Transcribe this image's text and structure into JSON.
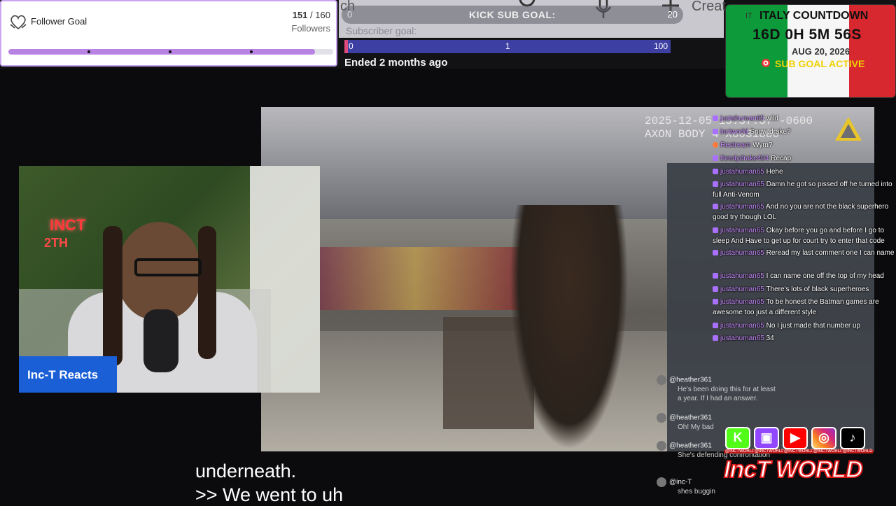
{
  "follower_goal": {
    "title": "Follower Goal",
    "current": "151",
    "separator": "/",
    "target": "160",
    "count_text": "151 / 160",
    "unit": "Followers",
    "progress_fraction": 0.944,
    "colors": {
      "fill": "#b883e3",
      "border": "#c9a6f0"
    },
    "icon": "heart-hands-icon"
  },
  "background_page": {
    "partial_label_left": "ch",
    "create_label": "Creat",
    "icons": [
      "search-icon",
      "microphone-icon",
      "plus-icon"
    ]
  },
  "kick_sub_goal": {
    "label": "KICK SUB GOAL:",
    "start": "0",
    "target": "20"
  },
  "subscriber_goal": {
    "label": "Subscriber goal:",
    "ticks": [
      "0",
      "1",
      "100"
    ],
    "status": "Ended 2 months ago",
    "colors": {
      "bar": "#3d3fa3",
      "edge": "#e04a7a"
    }
  },
  "italy_countdown": {
    "flag_prefix": "IT",
    "title": "ITALY COUNTDOWN",
    "timer": "16D 0H 5M 56S",
    "date": "AUG 20, 2026",
    "status": "SUB GOAL ACTIVE",
    "colors": {
      "green": "#0d9a3a",
      "white": "#f6f6f6",
      "red": "#d8282f",
      "status": "#f0d200"
    }
  },
  "bodycam": {
    "timestamp": "2025-12-05 15:37:37 -0600",
    "device": "AXON BODY 4 X6031886"
  },
  "facecam": {
    "neon_sign_line1": "INCT",
    "neon_sign_line2": "2TH",
    "label": "Inc-T Reacts",
    "label_color": "#1a5fd6"
  },
  "chat": [
    {
      "user": "justahuman65",
      "text": "wild",
      "badge": "twitch"
    },
    {
      "user": "inctworld",
      "text": "Snow drake?",
      "badge": "twitch"
    },
    {
      "user": "Restream",
      "text": "Wym?",
      "badge": "restream"
    },
    {
      "user": "thredydrake404",
      "text": "Recap",
      "badge": "twitch"
    },
    {
      "user": "justahuman65",
      "text": "Hehe",
      "badge": "twitch"
    },
    {
      "user": "justahuman65",
      "text": "Damn he got so pissed off he turned into full Anti-Venom",
      "badge": "twitch"
    },
    {
      "user": "justahuman65",
      "text": "And no you are not the black superhero good try though LOL",
      "badge": "twitch"
    },
    {
      "user": "justahuman65",
      "text": "Okay before you go and before I go to sleep And Have to get up for court try to enter that code",
      "badge": "twitch"
    },
    {
      "user": "justahuman65",
      "text": "Reread my last comment one I can name",
      "badge": "twitch"
    },
    {
      "user": "justahuman65",
      "text": "I can name one off the top of my head",
      "badge": "twitch"
    },
    {
      "user": "justahuman65",
      "text": "There's lots of black superheroes",
      "badge": "twitch"
    },
    {
      "user": "justahuman65",
      "text": "To be honest the Batman games are awesome too just a different style",
      "badge": "twitch"
    },
    {
      "user": "justahuman65",
      "text": "No I just made that number up",
      "badge": "twitch"
    },
    {
      "user": "justahuman65",
      "text": "34",
      "badge": "twitch"
    }
  ],
  "video_chat": [
    {
      "user": "@heather361",
      "text": "He's been doing this for at least a year. If I had an answer."
    },
    {
      "user": "@heather361",
      "text": "Oh! My bad"
    },
    {
      "user": "@heather361",
      "text": "She's defending confrontation"
    },
    {
      "user": "@inc-T",
      "text": "shes buggin"
    }
  ],
  "subtitles": {
    "line1": "underneath.",
    "line2": ">> We went to uh"
  },
  "socials": {
    "handle_tag": "@INCTWORLD",
    "icons": [
      "kick-icon",
      "twitch-icon",
      "youtube-icon",
      "instagram-icon",
      "tiktok-icon"
    ],
    "glyphs": [
      "K",
      "▣",
      "▶",
      "◎",
      "♪"
    ],
    "brand": "IncT WORLD"
  }
}
